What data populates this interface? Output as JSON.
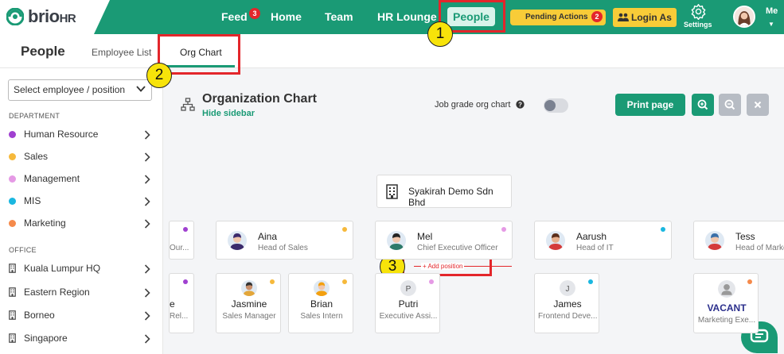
{
  "header": {
    "logo": {
      "brand": "brio",
      "suffix": "HR"
    },
    "nav": [
      {
        "key": "feed",
        "label": "Feed",
        "badge": "3"
      },
      {
        "key": "home",
        "label": "Home"
      },
      {
        "key": "team",
        "label": "Team"
      },
      {
        "key": "hr_lounge",
        "label": "HR Lounge"
      },
      {
        "key": "people",
        "label": "People",
        "active": true
      }
    ],
    "pending_actions": {
      "label": "Pending Actions",
      "badge": "2"
    },
    "login_as": "Login As",
    "settings": "Settings",
    "me": "Me"
  },
  "tabs": {
    "page_title": "People",
    "items": [
      {
        "label": "Employee List"
      },
      {
        "label": "Org Chart",
        "active": true
      }
    ]
  },
  "sidebar": {
    "select_placeholder": "Select employee / position",
    "department_heading": "DEPARTMENT",
    "departments": [
      {
        "label": "Human Resource",
        "color": "#a040d0"
      },
      {
        "label": "Sales",
        "color": "#f6b93b"
      },
      {
        "label": "Management",
        "color": "#e59ae5"
      },
      {
        "label": "MIS",
        "color": "#1ab7e0"
      },
      {
        "label": "Marketing",
        "color": "#f58a4b"
      }
    ],
    "office_heading": "OFFICE",
    "offices": [
      {
        "label": "Kuala Lumpur HQ"
      },
      {
        "label": "Eastern Region"
      },
      {
        "label": "Borneo"
      },
      {
        "label": "Singapore"
      }
    ]
  },
  "main": {
    "title": "Organization Chart",
    "hide_sidebar": "Hide sidebar",
    "job_grade_label": "Job grade org chart",
    "job_grade_on": false,
    "print": "Print page"
  },
  "org": {
    "company": "Syakirah Demo Sdn Bhd",
    "add_position": "+ Add position",
    "cards": [
      {
        "name": "",
        "role": "Our...",
        "color": "#a040d0"
      },
      {
        "name": "Aina",
        "role": "Head of Sales",
        "color": "#f6b93b"
      },
      {
        "name": "Mel",
        "role": "Chief Executive Officer",
        "color": "#e59ae5"
      },
      {
        "name": "Aarush",
        "role": "Head of IT",
        "color": "#1ab7e0"
      },
      {
        "name": "Tess",
        "role": "Head of Marke...",
        "color": "#f58a4b"
      },
      {
        "name": "e",
        "role": "Rel...",
        "color": "#a040d0"
      },
      {
        "name": "Jasmine",
        "role": "Sales Manager",
        "color": "#f6b93b"
      },
      {
        "name": "Brian",
        "role": "Sales Intern",
        "color": "#f6b93b"
      },
      {
        "name": "Putri",
        "role": "Executive Assi...",
        "color": "#e59ae5",
        "initial": "P"
      },
      {
        "name": "James",
        "role": "Frontend Deve...",
        "color": "#1ab7e0",
        "initial": "J"
      },
      {
        "name": "VACANT",
        "role": "Marketing Exe...",
        "color": "#f58a4b"
      }
    ]
  },
  "annotations": [
    "1",
    "2",
    "3"
  ]
}
